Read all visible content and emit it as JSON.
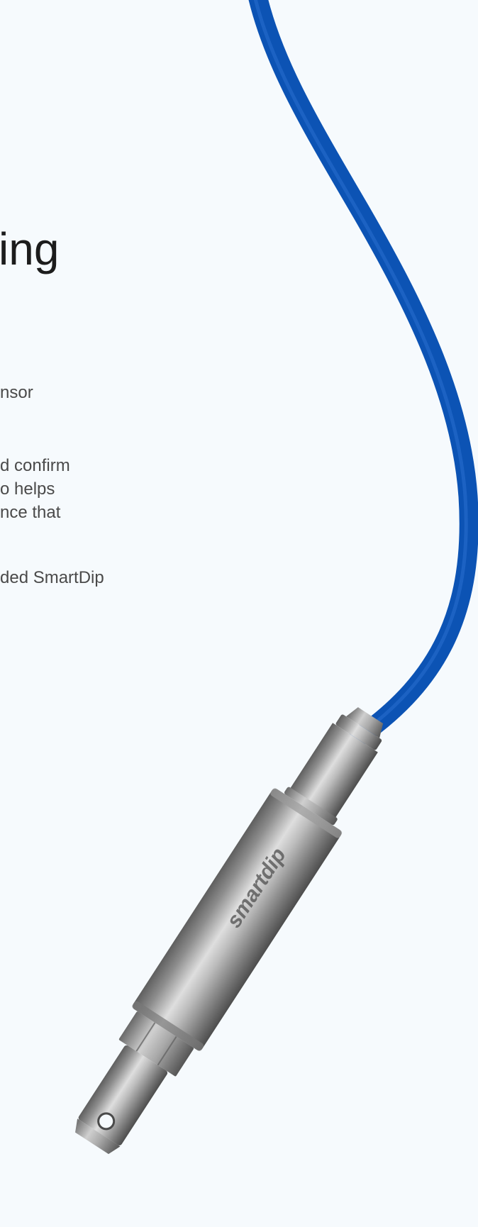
{
  "heading": "ing",
  "paragraphs": [
    {
      "lines": [
        "nsor"
      ]
    },
    {
      "lines": [
        "d confirm",
        "o helps",
        "nce that"
      ]
    },
    {
      "lines": [
        "ded SmartDip"
      ]
    }
  ],
  "product": {
    "name": "SmartDip sensor",
    "cable_color": "#0a52b5",
    "engraving": "smartdip"
  }
}
